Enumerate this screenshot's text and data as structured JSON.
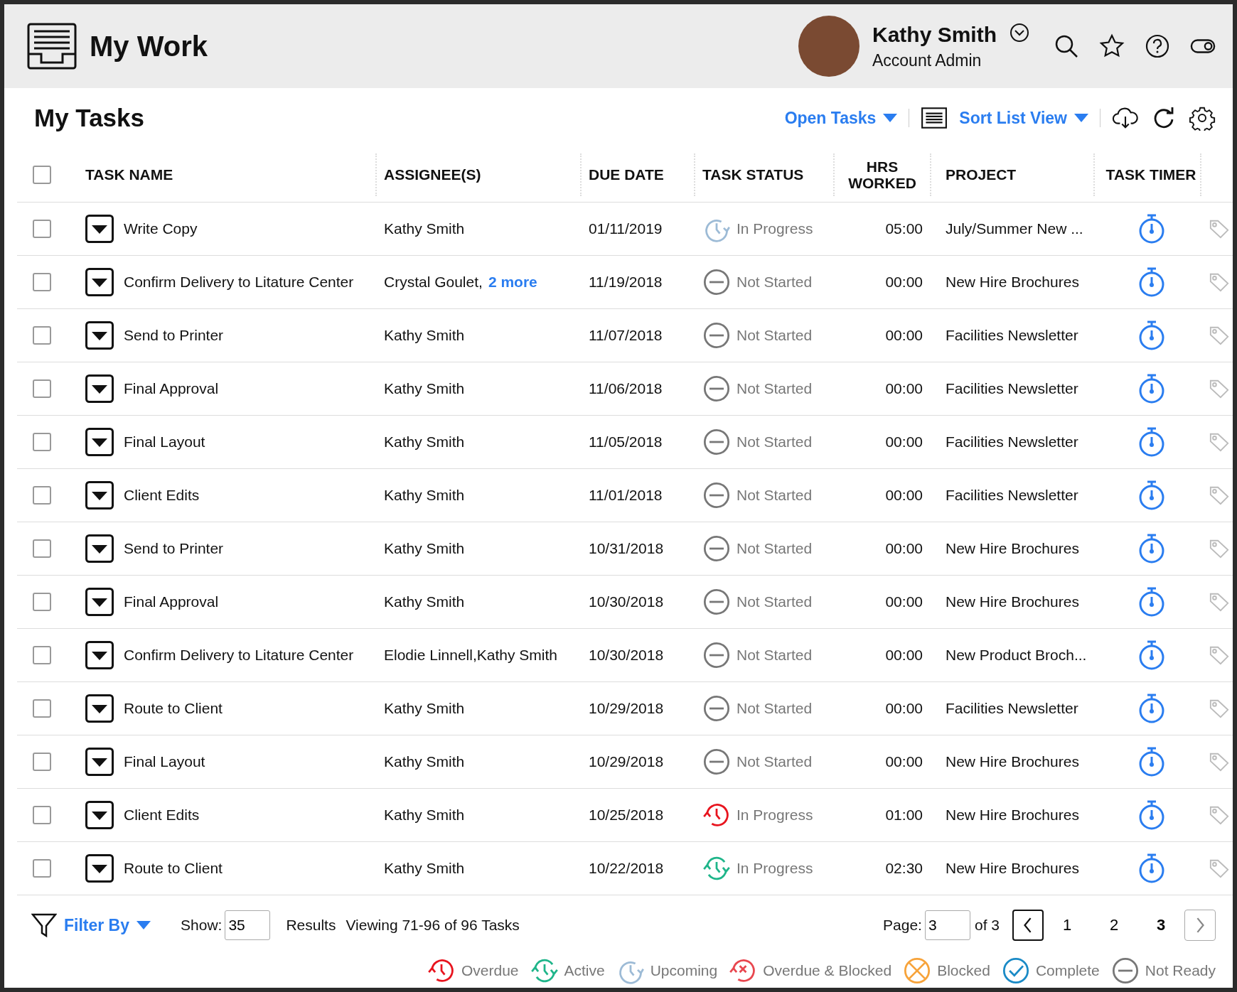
{
  "app": {
    "title": "My Work"
  },
  "user": {
    "name": "Kathy Smith",
    "role": "Account Admin"
  },
  "page_title": "My Tasks",
  "toolbar": {
    "filter_menu": "Open Tasks",
    "sort_menu": "Sort List View"
  },
  "table": {
    "select_all_checked": false,
    "columns": [
      "TASK NAME",
      "ASSIGNEE(S)",
      "DUE DATE",
      "TASK STATUS",
      "HRS WORKED",
      "PROJECT",
      "TASK TIMER"
    ],
    "rows": [
      {
        "checked": false,
        "task": "Write Copy",
        "assignee": "Kathy Smith",
        "due": "01/11/2019",
        "status": {
          "kind": "upcoming",
          "label": "In Progress"
        },
        "hrs": "05:00",
        "project": "July/Summer New ..."
      },
      {
        "checked": false,
        "task": "Confirm Delivery to Litature Center",
        "assignee": "Crystal Goulet,",
        "more": "2 more",
        "due": "11/19/2018",
        "status": {
          "kind": "not_started",
          "label": "Not Started"
        },
        "hrs": "00:00",
        "project": "New Hire Brochures"
      },
      {
        "checked": false,
        "task": "Send to Printer",
        "assignee": "Kathy Smith",
        "due": "11/07/2018",
        "status": {
          "kind": "not_started",
          "label": "Not Started"
        },
        "hrs": "00:00",
        "project": "Facilities Newsletter"
      },
      {
        "checked": false,
        "task": "Final Approval",
        "assignee": "Kathy Smith",
        "due": "11/06/2018",
        "status": {
          "kind": "not_started",
          "label": "Not Started"
        },
        "hrs": "00:00",
        "project": "Facilities Newsletter"
      },
      {
        "checked": false,
        "task": "Final Layout",
        "assignee": "Kathy Smith",
        "due": "11/05/2018",
        "status": {
          "kind": "not_started",
          "label": "Not Started"
        },
        "hrs": "00:00",
        "project": "Facilities Newsletter"
      },
      {
        "checked": false,
        "task": "Client Edits",
        "assignee": "Kathy Smith",
        "due": "11/01/2018",
        "status": {
          "kind": "not_started",
          "label": "Not Started"
        },
        "hrs": "00:00",
        "project": "Facilities Newsletter"
      },
      {
        "checked": false,
        "task": "Send to Printer",
        "assignee": "Kathy Smith",
        "due": "10/31/2018",
        "status": {
          "kind": "not_started",
          "label": "Not Started"
        },
        "hrs": "00:00",
        "project": "New Hire Brochures"
      },
      {
        "checked": false,
        "task": "Final Approval",
        "assignee": "Kathy Smith",
        "due": "10/30/2018",
        "status": {
          "kind": "not_started",
          "label": "Not Started"
        },
        "hrs": "00:00",
        "project": "New Hire Brochures"
      },
      {
        "checked": false,
        "task": "Confirm Delivery to Litature Center",
        "assignee": "Elodie Linnell,Kathy Smith",
        "due": "10/30/2018",
        "status": {
          "kind": "not_started",
          "label": "Not Started"
        },
        "hrs": "00:00",
        "project": "New Product Broch..."
      },
      {
        "checked": false,
        "task": "Route to Client",
        "assignee": "Kathy Smith",
        "due": "10/29/2018",
        "status": {
          "kind": "not_started",
          "label": "Not Started"
        },
        "hrs": "00:00",
        "project": "Facilities Newsletter"
      },
      {
        "checked": false,
        "task": "Final Layout",
        "assignee": "Kathy Smith",
        "due": "10/29/2018",
        "status": {
          "kind": "not_started",
          "label": "Not Started"
        },
        "hrs": "00:00",
        "project": "New Hire Brochures"
      },
      {
        "checked": false,
        "task": "Client Edits",
        "assignee": "Kathy Smith",
        "due": "10/25/2018",
        "status": {
          "kind": "overdue",
          "label": "In Progress"
        },
        "hrs": "01:00",
        "project": "New Hire Brochures"
      },
      {
        "checked": false,
        "task": "Route to Client",
        "assignee": "Kathy Smith",
        "due": "10/22/2018",
        "status": {
          "kind": "active",
          "label": "In Progress"
        },
        "hrs": "02:30",
        "project": "New Hire Brochures"
      }
    ]
  },
  "footer": {
    "filter_by": "Filter By",
    "show_label": "Show:",
    "show_value": "35",
    "results_label": "Results",
    "viewing": "Viewing 71-96 of 96 Tasks",
    "page_label": "Page:",
    "page_value": "3",
    "page_of": "of 3",
    "pages": [
      {
        "label": "1",
        "selected": false
      },
      {
        "label": "2",
        "selected": false
      },
      {
        "label": "3",
        "selected": true
      }
    ]
  },
  "legend": [
    {
      "kind": "overdue",
      "label": "Overdue"
    },
    {
      "kind": "active",
      "label": "Active"
    },
    {
      "kind": "upcoming",
      "label": "Upcoming"
    },
    {
      "kind": "overdue_blocked",
      "label": "Overdue & Blocked"
    },
    {
      "kind": "blocked",
      "label": "Blocked"
    },
    {
      "kind": "complete",
      "label": "Complete"
    },
    {
      "kind": "not_ready",
      "label": "Not Ready"
    }
  ]
}
